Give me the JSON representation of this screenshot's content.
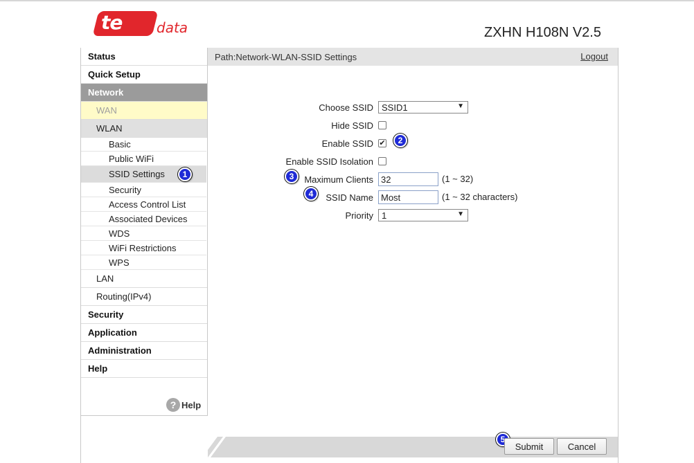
{
  "brand": {
    "logo_text": "te",
    "logo_suffix": "data",
    "model": "ZXHN H108N V2.5"
  },
  "sidebar": {
    "status": "Status",
    "quick_setup": "Quick Setup",
    "network": "Network",
    "wan": "WAN",
    "wlan": "WLAN",
    "wlan_items": [
      "Basic",
      "Public WiFi",
      "SSID Settings",
      "Security",
      "Access Control List",
      "Associated Devices",
      "WDS",
      "WiFi Restrictions",
      "WPS"
    ],
    "lan": "LAN",
    "routing": "Routing(IPv4)",
    "security": "Security",
    "application": "Application",
    "administration": "Administration",
    "help": "Help",
    "help_link": "Help",
    "help_icon_glyph": "?"
  },
  "path": {
    "text": "Path:Network-WLAN-SSID Settings",
    "logout": "Logout"
  },
  "form": {
    "choose_ssid_label": "Choose SSID",
    "choose_ssid_value": "SSID1",
    "hide_ssid_label": "Hide SSID",
    "hide_ssid_checked": false,
    "enable_ssid_label": "Enable SSID",
    "enable_ssid_checked": true,
    "isolation_label": "Enable SSID Isolation",
    "isolation_checked": false,
    "max_clients_label": "Maximum Clients",
    "max_clients_value": "32",
    "max_clients_hint": "(1 ~ 32)",
    "ssid_name_label": "SSID Name",
    "ssid_name_value": "Most",
    "ssid_name_hint": "(1 ~ 32 characters)",
    "priority_label": "Priority",
    "priority_value": "1",
    "check_glyph": "✔"
  },
  "buttons": {
    "submit": "Submit",
    "cancel": "Cancel"
  },
  "annotations": {
    "badge1": "1",
    "badge2": "2",
    "badge3": "3",
    "badge4": "4",
    "badge5": "5"
  },
  "colors": {
    "brand_red": "#e1262c",
    "badge_blue": "#1f2bd6",
    "menu_active": "#9b9b9b"
  }
}
